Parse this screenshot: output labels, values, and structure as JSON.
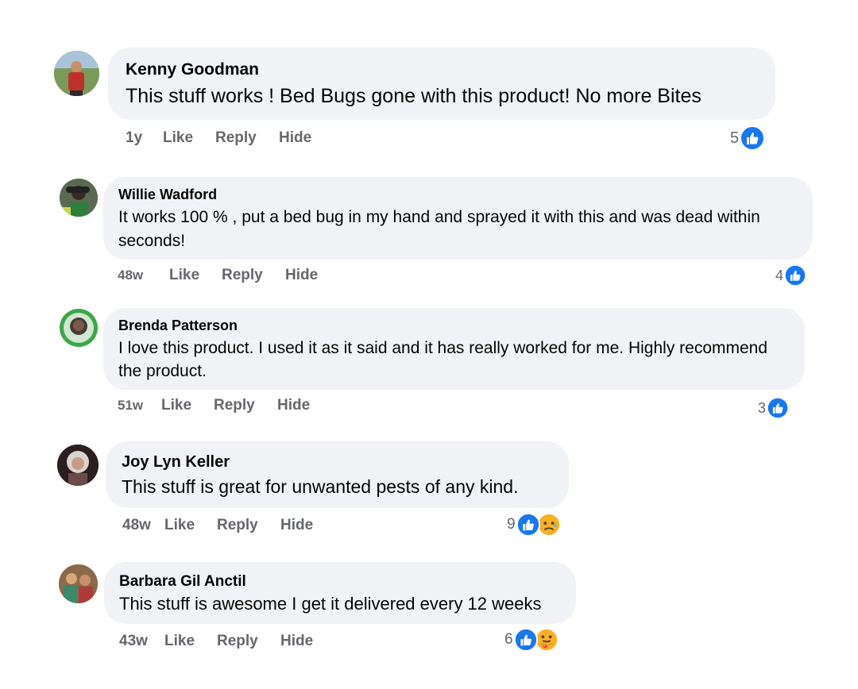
{
  "comments": [
    {
      "name": "Kenny Goodman",
      "text": "This stuff works ! Bed Bugs gone with this product! No more Bites",
      "time": "1y",
      "like_label": "Like",
      "reply_label": "Reply",
      "hide_label": "Hide",
      "reaction_count": "5",
      "reactions": [
        "like-icon"
      ]
    },
    {
      "name": "Willie Wadford",
      "text": "It works 100 % , put a bed bug in my hand and sprayed it with this and was dead within seconds!",
      "time": "48w",
      "like_label": "Like",
      "reply_label": "Reply",
      "hide_label": "Hide",
      "reaction_count": "4",
      "reactions": [
        "like-icon"
      ]
    },
    {
      "name": "Brenda Patterson",
      "text": "I love this product. I used it as it said and it has really worked for me. Highly recommend the product.",
      "time": "51w",
      "like_label": "Like",
      "reply_label": "Reply",
      "hide_label": "Hide",
      "reaction_count": "3",
      "reactions": [
        "like-icon"
      ]
    },
    {
      "name": "Joy Lyn Keller",
      "text": "This stuff is great for unwanted pests of any kind.",
      "time": "48w",
      "like_label": "Like",
      "reply_label": "Reply",
      "hide_label": "Hide",
      "reaction_count": "9",
      "reactions": [
        "like-icon",
        "sad-face-icon"
      ]
    },
    {
      "name": "Barbara Gil Anctil",
      "text": "This stuff is awesome I get it delivered every 12 weeks",
      "time": "43w",
      "like_label": "Like",
      "reply_label": "Reply",
      "hide_label": "Hide",
      "reaction_count": "6",
      "reactions": [
        "like-icon",
        "care-hug-icon"
      ]
    }
  ],
  "colors": {
    "bubble": "#f0f2f5",
    "action_text": "#65676b",
    "like_blue": "#1877f2",
    "emoji_yellow": "#f7b125"
  }
}
